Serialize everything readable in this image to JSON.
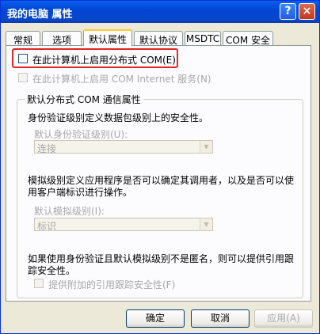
{
  "window": {
    "title": "我的电脑  属性",
    "help_label": "?",
    "close_label": "×"
  },
  "tabs": [
    {
      "label": "常规"
    },
    {
      "label": "选项"
    },
    {
      "label": "默认属性",
      "active": true
    },
    {
      "label": "默认协议"
    },
    {
      "label": "MSDTC"
    },
    {
      "label": "COM 安全"
    }
  ],
  "options": {
    "enable_dcom": {
      "label": "在此计算机上启用分布式 COM(E)",
      "checked": false
    },
    "enable_com_internet": {
      "label": "在此计算机上启用 COM Internet 服务(N)",
      "checked": false
    }
  },
  "group": {
    "title": "默认分布式 COM 通信属性",
    "auth_desc": "身份验证级别定义数据包级别上的安全性。",
    "auth_label": "默认身份验证级别(U):",
    "auth_value": "连接",
    "imp_desc_1": "模拟级别定义应用程序是否可以确定其调用者，以及是否可以使",
    "imp_desc_2": "用客户端标识进行操作。",
    "imp_label": "默认模拟级别(I):",
    "imp_value": "标识",
    "ref_desc_1": "如果使用身份验证且默认模拟级别不是匿名，则可以提供引用跟",
    "ref_desc_2": "踪安全性。",
    "ref_checkbox_label": "提供附加的引用跟踪安全性(F)"
  },
  "buttons": {
    "ok": "确定",
    "cancel": "取消",
    "apply": "应用(A)"
  },
  "colors": {
    "titlebar": "#0054e3",
    "highlight": "#e32626",
    "panel": "#fcfcfe"
  }
}
